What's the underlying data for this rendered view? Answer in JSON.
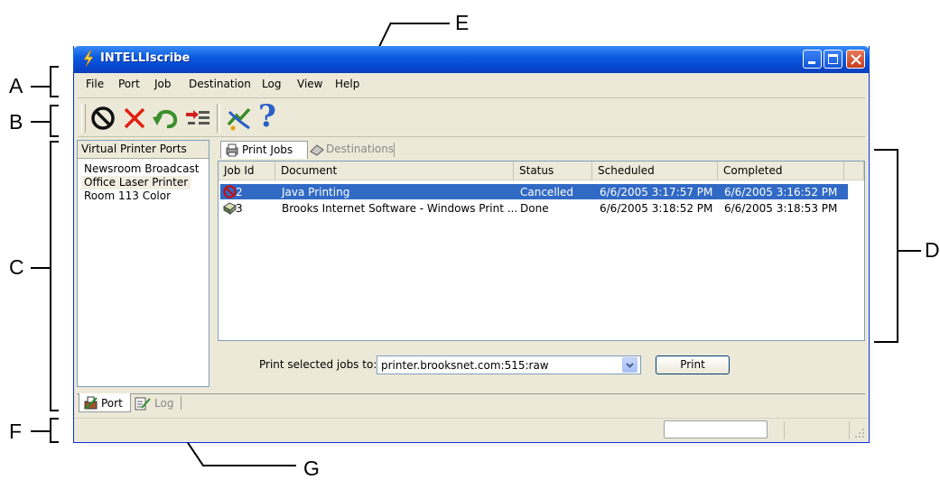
{
  "window": {
    "title": "INTELLIscribe"
  },
  "menu": [
    "File",
    "Port",
    "Job",
    "Destination",
    "Log",
    "View",
    "Help"
  ],
  "toolbar": {
    "icons": [
      "cancel-job-icon",
      "delete-icon",
      "undo-icon",
      "reprint-icon",
      "edit-icon",
      "help-icon"
    ]
  },
  "ports": {
    "header": "Virtual Printer Ports",
    "items": [
      "Newsroom Broadcast",
      "Office Laser Printer",
      "Room 113 Color"
    ]
  },
  "tabs": {
    "print_jobs": "Print Jobs",
    "destinations": "Destinations"
  },
  "jobs": {
    "columns": [
      "Job Id",
      "Document",
      "Status",
      "Scheduled",
      "Completed"
    ],
    "rows": [
      {
        "id": "2",
        "document": "Java Printing",
        "status": "Cancelled",
        "scheduled": "6/6/2005 3:17:57 PM",
        "completed": "6/6/2005 3:16:52 PM"
      },
      {
        "id": "3",
        "document": "Brooks Internet Software - Windows Print ...",
        "status": "Done",
        "scheduled": "6/6/2005 3:18:52 PM",
        "completed": "6/6/2005 3:18:53 PM"
      }
    ]
  },
  "print_bar": {
    "label": "Print selected jobs to:",
    "destination": "printer.brooksnet.com:515:raw",
    "button": "Print"
  },
  "bottom_tabs": {
    "port": "Port",
    "log": "Log"
  },
  "annotations": {
    "a": "A",
    "b": "B",
    "c": "C",
    "d": "D",
    "e": "E",
    "f": "F",
    "g": "G"
  },
  "colors": {
    "title_blue": "#0a5ce0",
    "selection": "#316ac5",
    "window_bg": "#ece9d8"
  }
}
